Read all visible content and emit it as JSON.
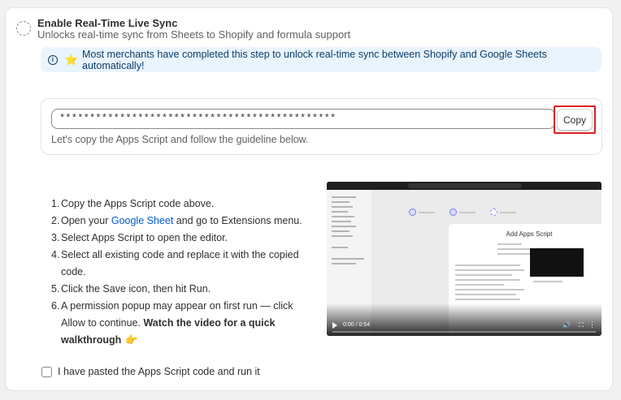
{
  "step": {
    "title": "Enable Real-Time Live Sync",
    "subtitle": "Unlocks real-time sync from Sheets to Shopify and formula support"
  },
  "banner": {
    "icon": "info-icon",
    "emoji": "⭐",
    "text": "Most merchants have completed this step to unlock real-time sync between Shopify and Google Sheets automatically!"
  },
  "script": {
    "masked_value": "**********************************************",
    "copy_label": "Copy",
    "help_text": "Let's copy the Apps Script and follow the guideline below."
  },
  "instructions": [
    {
      "num": "1.",
      "pre": "Copy the Apps Script code above.",
      "link": "",
      "post": "",
      "bold": "",
      "emoji": ""
    },
    {
      "num": "2.",
      "pre": "Open your ",
      "link": "Google Sheet",
      "post": " and go to Extensions menu.",
      "bold": "",
      "emoji": ""
    },
    {
      "num": "3.",
      "pre": "Select Apps Script to open the editor.",
      "link": "",
      "post": "",
      "bold": "",
      "emoji": ""
    },
    {
      "num": "4.",
      "pre": "Select all existing code and replace it with the copied code.",
      "link": "",
      "post": "",
      "bold": "",
      "emoji": ""
    },
    {
      "num": "5.",
      "pre": "Click the Save icon, then hit Run.",
      "link": "",
      "post": "",
      "bold": "",
      "emoji": ""
    },
    {
      "num": "6.",
      "pre": "A permission popup may appear on first run — click Allow to continue. ",
      "link": "",
      "post": "",
      "bold": "Watch the video for a quick walkthrough",
      "emoji": "👉"
    }
  ],
  "video": {
    "heading": "Add Apps Script",
    "time": "0:00 / 0:54"
  },
  "confirm": {
    "label": "I have pasted the Apps Script code and run it"
  }
}
